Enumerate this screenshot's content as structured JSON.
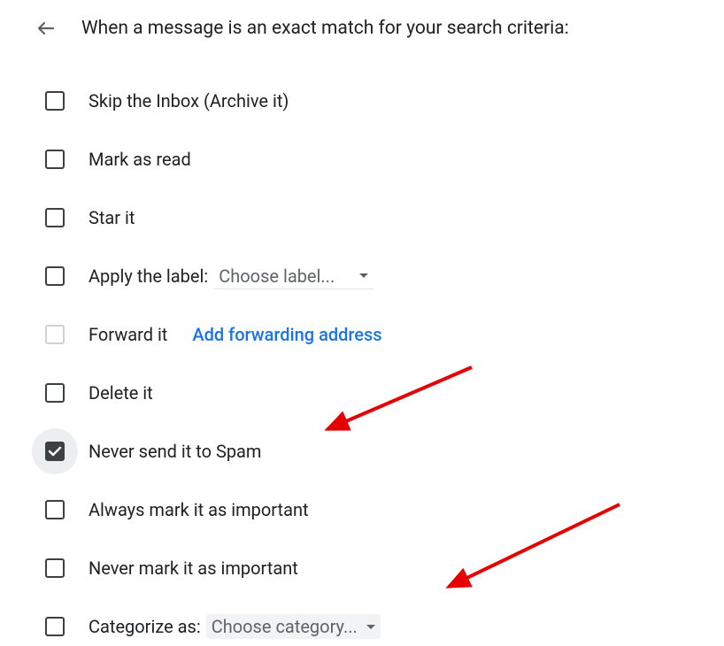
{
  "header": {
    "title": "When a message is an exact match for your search criteria:"
  },
  "options": {
    "skip_inbox": "Skip the Inbox (Archive it)",
    "mark_read": "Mark as read",
    "star_it": "Star it",
    "apply_label": "Apply the label:",
    "apply_label_dropdown": "Choose label...",
    "forward_it": "Forward it",
    "forward_link": "Add forwarding address",
    "delete_it": "Delete it",
    "never_spam": "Never send it to Spam",
    "always_important": "Always mark it as important",
    "never_important": "Never mark it as important",
    "categorize_as": "Categorize as:",
    "categorize_dropdown": "Choose category..."
  },
  "state": {
    "never_spam_checked": true
  },
  "annotations": {
    "arrow1_target": "never_spam",
    "arrow2_target": "categorize_dropdown"
  }
}
